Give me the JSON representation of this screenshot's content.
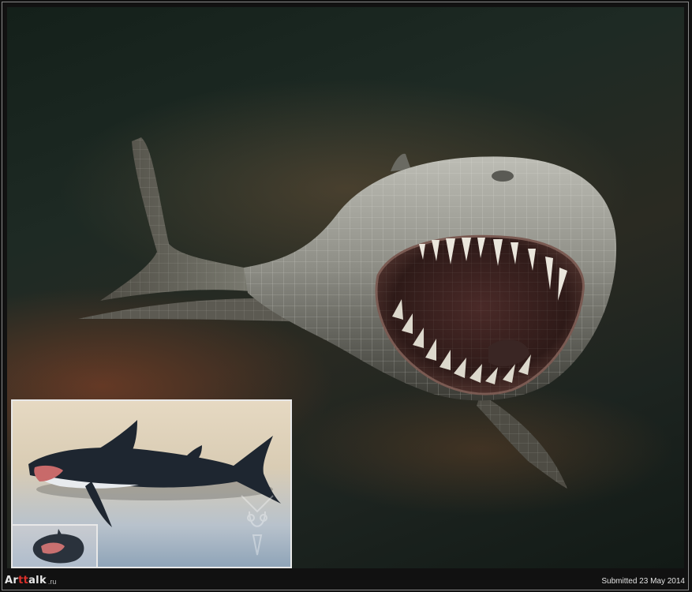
{
  "brand": {
    "name_prefix": "Ar",
    "name_mid": "tt",
    "name_suffix": "alk",
    "tld": ".ru"
  },
  "submitted_label": "Submitted 23 May 2014",
  "colors": {
    "accent": "#d8302a",
    "frame": "#111111",
    "border": "#e8e8e8"
  },
  "images": {
    "main": "wireframe-shark-render",
    "inset": "textured-shark-render",
    "inset_small": "shark-front-thumbnail",
    "watermark": "artist-logo-watermark"
  }
}
